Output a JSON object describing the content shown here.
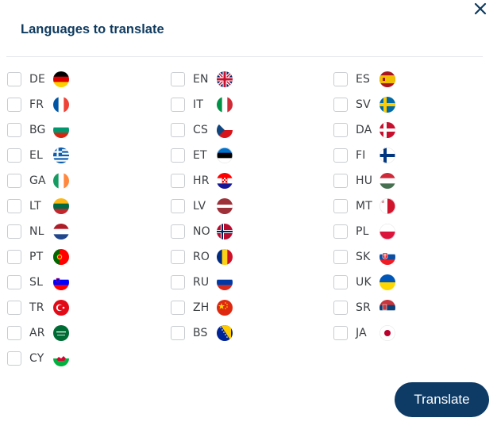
{
  "dialog": {
    "title": "Languages to translate",
    "translate_label": "Translate"
  },
  "columns": [
    [
      {
        "code": "DE",
        "flag": "de-flag-icon"
      },
      {
        "code": "FR",
        "flag": "fr-flag-icon"
      },
      {
        "code": "BG",
        "flag": "bg-flag-icon"
      },
      {
        "code": "EL",
        "flag": "el-flag-icon"
      },
      {
        "code": "GA",
        "flag": "ga-flag-icon"
      },
      {
        "code": "LT",
        "flag": "lt-flag-icon"
      },
      {
        "code": "NL",
        "flag": "nl-flag-icon"
      },
      {
        "code": "PT",
        "flag": "pt-flag-icon"
      },
      {
        "code": "SL",
        "flag": "sl-flag-icon"
      },
      {
        "code": "TR",
        "flag": "tr-flag-icon"
      },
      {
        "code": "AR",
        "flag": "ar-flag-icon"
      },
      {
        "code": "CY",
        "flag": "cy-flag-icon"
      }
    ],
    [
      {
        "code": "EN",
        "flag": "en-flag-icon"
      },
      {
        "code": "IT",
        "flag": "it-flag-icon"
      },
      {
        "code": "CS",
        "flag": "cs-flag-icon"
      },
      {
        "code": "ET",
        "flag": "et-flag-icon"
      },
      {
        "code": "HR",
        "flag": "hr-flag-icon"
      },
      {
        "code": "LV",
        "flag": "lv-flag-icon"
      },
      {
        "code": "NO",
        "flag": "no-flag-icon"
      },
      {
        "code": "RO",
        "flag": "ro-flag-icon"
      },
      {
        "code": "RU",
        "flag": "ru-flag-icon"
      },
      {
        "code": "ZH",
        "flag": "zh-flag-icon"
      },
      {
        "code": "BS",
        "flag": "bs-flag-icon"
      }
    ],
    [
      {
        "code": "ES",
        "flag": "es-flag-icon"
      },
      {
        "code": "SV",
        "flag": "sv-flag-icon"
      },
      {
        "code": "DA",
        "flag": "da-flag-icon"
      },
      {
        "code": "FI",
        "flag": "fi-flag-icon"
      },
      {
        "code": "HU",
        "flag": "hu-flag-icon"
      },
      {
        "code": "MT",
        "flag": "mt-flag-icon"
      },
      {
        "code": "PL",
        "flag": "pl-flag-icon"
      },
      {
        "code": "SK",
        "flag": "sk-flag-icon"
      },
      {
        "code": "UK",
        "flag": "uk-flag-icon"
      },
      {
        "code": "SR",
        "flag": "sr-flag-icon"
      },
      {
        "code": "JA",
        "flag": "ja-flag-icon"
      }
    ]
  ],
  "colors": {
    "title": "#0f3b5f",
    "button_bg": "#0d3b66",
    "button_text": "#ffffff",
    "checkbox_border": "#c8ccd0",
    "divider": "#e3e6ea"
  }
}
